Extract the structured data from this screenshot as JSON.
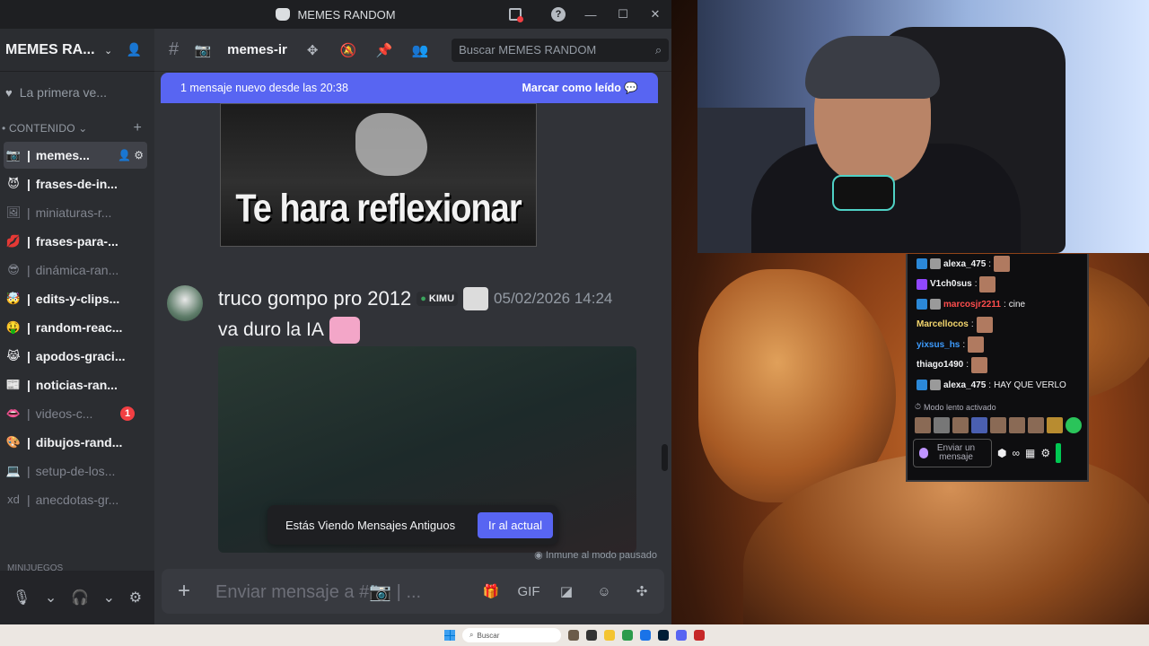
{
  "window": {
    "title": "MEMES RANDOM",
    "minimize": "—",
    "maximize": "☐",
    "close": "✕",
    "help": "?"
  },
  "sidebar": {
    "server_name": "MEMES RA...",
    "chevron": "⌄",
    "pinned_item": "La primera ve...",
    "category": "CONTENIDO",
    "category_chevron": "⌄",
    "category_add": "+",
    "channels": [
      {
        "emoji": "📷",
        "name": "memes...",
        "state": "active"
      },
      {
        "emoji": "😈",
        "name": "frases-de-in...",
        "state": "unread"
      },
      {
        "emoji": "🖼",
        "name": "miniaturas-r...",
        "state": "muted"
      },
      {
        "emoji": "💋",
        "name": "frases-para-...",
        "state": "unread"
      },
      {
        "emoji": "😎",
        "name": "dinámica-ran...",
        "state": "muted"
      },
      {
        "emoji": "🤯",
        "name": "edits-y-clips...",
        "state": "unread"
      },
      {
        "emoji": "🤑",
        "name": "random-reac...",
        "state": "unread"
      },
      {
        "emoji": "😹",
        "name": "apodos-graci...",
        "state": "unread"
      },
      {
        "emoji": "📰",
        "name": "noticias-ran...",
        "state": "unread"
      },
      {
        "emoji": "👄",
        "name": "videos-c...",
        "state": "muted",
        "badge": "1"
      },
      {
        "emoji": "🎨",
        "name": "dibujos-rand...",
        "state": "unread"
      },
      {
        "emoji": "💻",
        "name": "setup-de-los...",
        "state": "muted"
      },
      {
        "emoji": "xd",
        "name": "anecdotas-gr...",
        "state": "muted"
      }
    ],
    "hidden_category": "MINIJUEGOS",
    "user_controls": [
      "🎙",
      "⌄",
      "🎧",
      "⌄",
      "⚙"
    ]
  },
  "channel_header": {
    "hash": "#",
    "channel": "memes-ir",
    "search_placeholder": "Buscar MEMES RANDOM",
    "search_icon": "⌕"
  },
  "banner": {
    "text": "1 mensaje nuevo desde las 20:38",
    "action": "Marcar como leído"
  },
  "meme_caption": "Te hara reflexionar",
  "message": {
    "author": "truco gompo pro 2012",
    "tag": "KIMU",
    "timestamp": "05/02/2026 14:24",
    "text": "va duro la IA"
  },
  "old_messages": {
    "text": "Estás Viendo Mensajes Antiguos",
    "button": "Ir al actual"
  },
  "paused_note": "Inmune al modo pausado",
  "composer": {
    "plus": "+",
    "placeholder": "Enviar mensaje a #📷",
    "separator": "|",
    "more": "...",
    "gif": "GIF"
  },
  "twitch_chat": {
    "messages": [
      {
        "user": "alexa_475",
        "color": "#f2f3f5",
        "text": "",
        "badges": [
          "blue",
          "gray"
        ],
        "emote": true
      },
      {
        "user": "V1ch0sus",
        "color": "#f2f3f5",
        "text": "",
        "badges": [
          "purple"
        ],
        "emote": true
      },
      {
        "user": "marcosjr2211",
        "color": "#ff4d4d",
        "text": "cine",
        "badges": [
          "blue",
          "gray"
        ],
        "emote": false
      },
      {
        "user": "Marcellocos",
        "color": "#f5d76e",
        "text": "",
        "badges": [],
        "emote": true
      },
      {
        "user": "yixsus_hs",
        "color": "#3d9cff",
        "text": "",
        "badges": [],
        "emote": true
      },
      {
        "user": "thiago1490",
        "color": "#f2f3f5",
        "text": "",
        "badges": [],
        "emote": true
      },
      {
        "user": "alexa_475",
        "color": "#f2f3f5",
        "text": "HAY QUE VERLO",
        "badges": [
          "blue",
          "gray"
        ],
        "emote": false
      }
    ],
    "slow_mode": "Modo lento activado",
    "input_placeholder": "Enviar un mensaje"
  },
  "taskbar": {
    "search": "Buscar"
  }
}
